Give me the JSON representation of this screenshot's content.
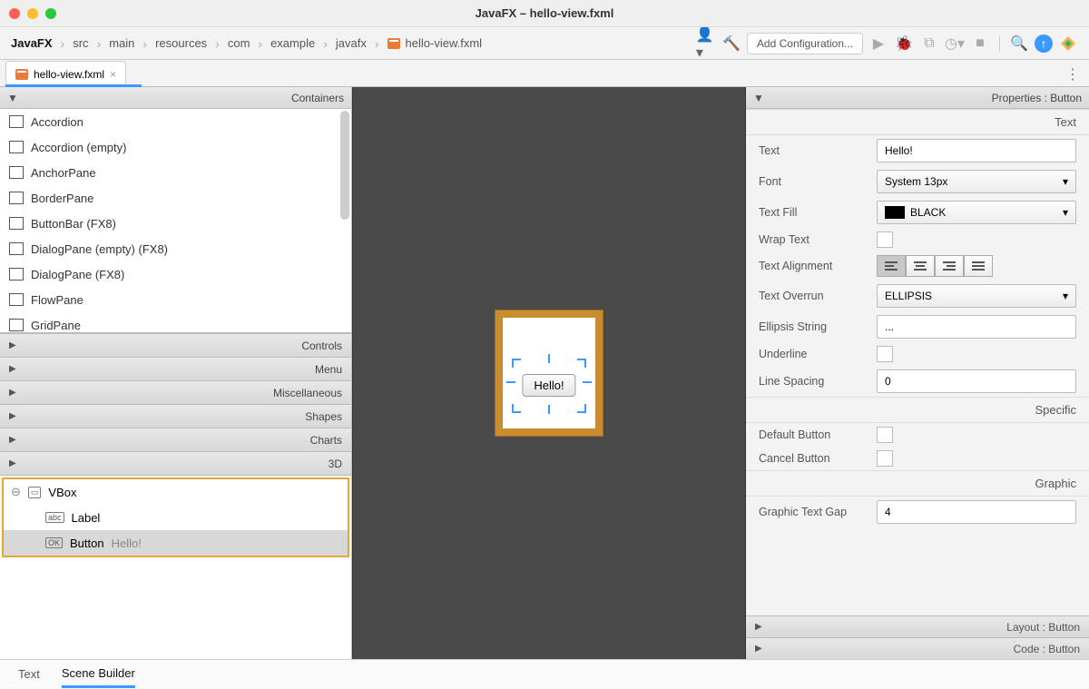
{
  "window": {
    "title": "JavaFX – hello-view.fxml"
  },
  "breadcrumb": [
    "JavaFX",
    "src",
    "main",
    "resources",
    "com",
    "example",
    "javafx",
    "hello-view.fxml"
  ],
  "toolbar": {
    "config_label": "Add Configuration..."
  },
  "editor_tab": {
    "name": "hello-view.fxml"
  },
  "left": {
    "header": "Containers",
    "items": [
      "Accordion",
      "Accordion  (empty)",
      "AnchorPane",
      "BorderPane",
      "ButtonBar  (FX8)",
      "DialogPane (empty)  (FX8)",
      "DialogPane  (FX8)",
      "FlowPane",
      "GridPane"
    ],
    "sections": [
      "Controls",
      "Menu",
      "Miscellaneous",
      "Shapes",
      "Charts",
      "3D"
    ]
  },
  "hierarchy": {
    "root": "VBox",
    "label_item": "Label",
    "button_item": "Button",
    "button_text": "Hello!"
  },
  "canvas": {
    "button_text": "Hello!"
  },
  "properties": {
    "header": "Properties : Button",
    "sec_text": "Text",
    "sec_specific": "Specific",
    "sec_graphic": "Graphic",
    "layout_header": "Layout : Button",
    "code_header": "Code : Button",
    "text_label": "Text",
    "text_value": "Hello!",
    "font_label": "Font",
    "font_value": "System 13px",
    "fill_label": "Text Fill",
    "fill_value": "BLACK",
    "wrap_label": "Wrap Text",
    "align_label": "Text Alignment",
    "overrun_label": "Text Overrun",
    "overrun_value": "ELLIPSIS",
    "ellipsis_label": "Ellipsis String",
    "ellipsis_value": "...",
    "underline_label": "Underline",
    "spacing_label": "Line Spacing",
    "spacing_value": "0",
    "defbtn_label": "Default Button",
    "cancelbtn_label": "Cancel Button",
    "gap_label": "Graphic Text Gap",
    "gap_value": "4"
  },
  "bottom_tabs": {
    "text": "Text",
    "sb": "Scene Builder"
  }
}
